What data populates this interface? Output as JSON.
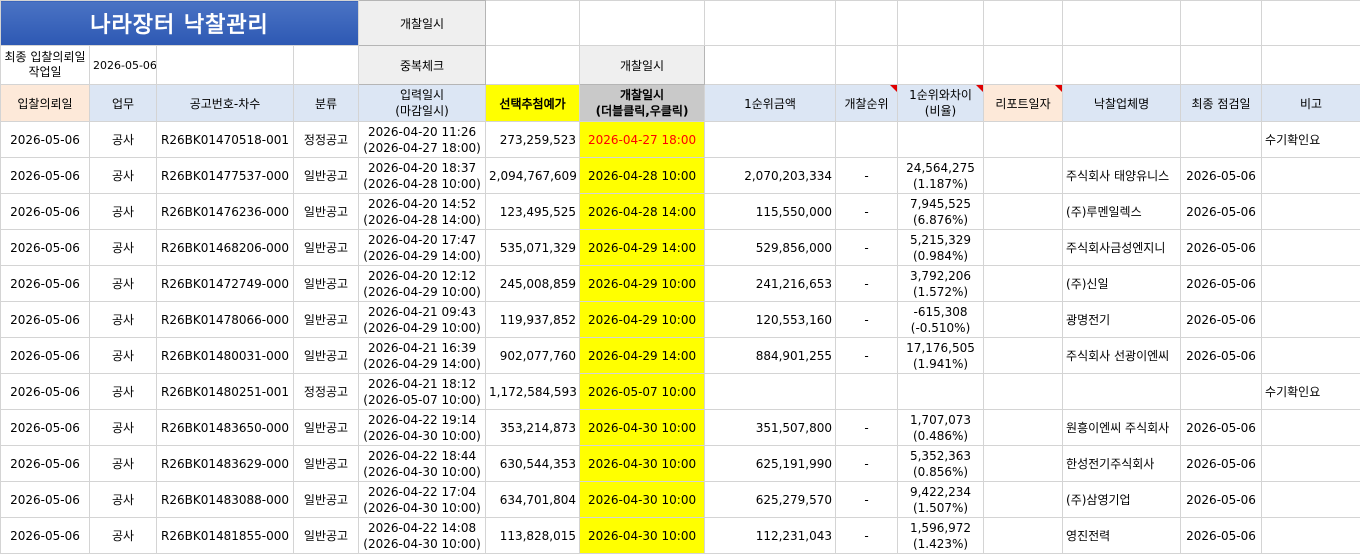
{
  "title": "나라장터 낙찰관리",
  "buttons": {
    "open_date_1": "개찰일시",
    "dup_check": "중복체크",
    "open_date_2": "개찰일시"
  },
  "work_date": {
    "label": "최종 입찰의뢰일 작업일",
    "value": "2026-05-06"
  },
  "headers": {
    "request_date": "입찰의뢰일",
    "task": "업무",
    "notice_no": "공고번호-차수",
    "category": "분류",
    "input_date_1": "입력일시",
    "input_date_2": "(마감일시)",
    "selected_price": "선택추첨예가",
    "open_date_1": "개찰일시",
    "open_date_2": "(더블클릭,우클릭)",
    "first_amount": "1순위금액",
    "open_rank": "개찰순위",
    "diff_1": "1순위와차이",
    "diff_2": "(비율)",
    "report_date": "리포트일자",
    "winner": "낙찰업체명",
    "final_check": "최종 점검일",
    "note": "비고"
  },
  "rows": [
    {
      "req": "2026-05-06",
      "task": "공사",
      "no": "R26BK01470518-001",
      "cat": "정정공고",
      "in1": "2026-04-20 11:26",
      "in2": "(2026-04-27 18:00)",
      "price": "273,259,523",
      "open": "2026-04-27  18:00",
      "amt": "",
      "rank": "",
      "d1": "",
      "d2": "",
      "report": "",
      "winner": "",
      "check": "",
      "note": "수기확인요"
    },
    {
      "req": "2026-05-06",
      "task": "공사",
      "no": "R26BK01477537-000",
      "cat": "일반공고",
      "in1": "2026-04-20 18:37",
      "in2": "(2026-04-28 10:00)",
      "price": "2,094,767,609",
      "open": "2026-04-28 10:00",
      "amt": "2,070,203,334",
      "rank": "-",
      "d1": "24,564,275",
      "d2": "(1.187%)",
      "report": "",
      "winner": "주식회사 태양유니스",
      "check": "2026-05-06",
      "note": ""
    },
    {
      "req": "2026-05-06",
      "task": "공사",
      "no": "R26BK01476236-000",
      "cat": "일반공고",
      "in1": "2026-04-20 14:52",
      "in2": "(2026-04-28 14:00)",
      "price": "123,495,525",
      "open": "2026-04-28 14:00",
      "amt": "115,550,000",
      "rank": "-",
      "d1": "7,945,525",
      "d2": "(6.876%)",
      "report": "",
      "winner": "(주)루멘일렉스",
      "check": "2026-05-06",
      "note": ""
    },
    {
      "req": "2026-05-06",
      "task": "공사",
      "no": "R26BK01468206-000",
      "cat": "일반공고",
      "in1": "2026-04-20 17:47",
      "in2": "(2026-04-29 14:00)",
      "price": "535,071,329",
      "open": "2026-04-29 14:00",
      "amt": "529,856,000",
      "rank": "-",
      "d1": "5,215,329",
      "d2": "(0.984%)",
      "report": "",
      "winner": "주식회사금성엔지니",
      "check": "2026-05-06",
      "note": ""
    },
    {
      "req": "2026-05-06",
      "task": "공사",
      "no": "R26BK01472749-000",
      "cat": "일반공고",
      "in1": "2026-04-20 12:12",
      "in2": "(2026-04-29 10:00)",
      "price": "245,008,859",
      "open": "2026-04-29 10:00",
      "amt": "241,216,653",
      "rank": "-",
      "d1": "3,792,206",
      "d2": "(1.572%)",
      "report": "",
      "winner": "(주)신일",
      "check": "2026-05-06",
      "note": ""
    },
    {
      "req": "2026-05-06",
      "task": "공사",
      "no": "R26BK01478066-000",
      "cat": "일반공고",
      "in1": "2026-04-21 09:43",
      "in2": "(2026-04-29 10:00)",
      "price": "119,937,852",
      "open": "2026-04-29 10:00",
      "amt": "120,553,160",
      "rank": "-",
      "d1": "-615,308",
      "d2": "(-0.510%)",
      "report": "",
      "winner": "광명전기",
      "check": "2026-05-06",
      "note": ""
    },
    {
      "req": "2026-05-06",
      "task": "공사",
      "no": "R26BK01480031-000",
      "cat": "일반공고",
      "in1": "2026-04-21 16:39",
      "in2": "(2026-04-29 14:00)",
      "price": "902,077,760",
      "open": "2026-04-29 14:00",
      "amt": "884,901,255",
      "rank": "-",
      "d1": "17,176,505",
      "d2": "(1.941%)",
      "report": "",
      "winner": "주식회사 선광이엔씨",
      "check": "2026-05-06",
      "note": ""
    },
    {
      "req": "2026-05-06",
      "task": "공사",
      "no": "R26BK01480251-001",
      "cat": "정정공고",
      "in1": "2026-04-21 18:12",
      "in2": "(2026-05-07 10:00)",
      "price": "1,172,584,593",
      "open": "2026-05-07 10:00",
      "amt": "",
      "rank": "",
      "d1": "",
      "d2": "",
      "report": "",
      "winner": "",
      "check": "",
      "note": "수기확인요"
    },
    {
      "req": "2026-05-06",
      "task": "공사",
      "no": "R26BK01483650-000",
      "cat": "일반공고",
      "in1": "2026-04-22 19:14",
      "in2": "(2026-04-30 10:00)",
      "price": "353,214,873",
      "open": "2026-04-30 10:00",
      "amt": "351,507,800",
      "rank": "-",
      "d1": "1,707,073",
      "d2": "(0.486%)",
      "report": "",
      "winner": "원흥이엔씨 주식회사",
      "check": "2026-05-06",
      "note": ""
    },
    {
      "req": "2026-05-06",
      "task": "공사",
      "no": "R26BK01483629-000",
      "cat": "일반공고",
      "in1": "2026-04-22 18:44",
      "in2": "(2026-04-30 10:00)",
      "price": "630,544,353",
      "open": "2026-04-30 10:00",
      "amt": "625,191,990",
      "rank": "-",
      "d1": "5,352,363",
      "d2": "(0.856%)",
      "report": "",
      "winner": "한성전기주식회사",
      "check": "2026-05-06",
      "note": ""
    },
    {
      "req": "2026-05-06",
      "task": "공사",
      "no": "R26BK01483088-000",
      "cat": "일반공고",
      "in1": "2026-04-22 17:04",
      "in2": "(2026-04-30 10:00)",
      "price": "634,701,804",
      "open": "2026-04-30 10:00",
      "amt": "625,279,570",
      "rank": "-",
      "d1": "9,422,234",
      "d2": "(1.507%)",
      "report": "",
      "winner": "(주)삼영기업",
      "check": "2026-05-06",
      "note": ""
    },
    {
      "req": "2026-05-06",
      "task": "공사",
      "no": "R26BK01481855-000",
      "cat": "일반공고",
      "in1": "2026-04-22 14:08",
      "in2": "(2026-04-30 10:00)",
      "price": "113,828,015",
      "open": "2026-04-30 10:00",
      "amt": "112,231,043",
      "rank": "-",
      "d1": "1,596,972",
      "d2": "(1.423%)",
      "report": "",
      "winner": "영진전력",
      "check": "2026-05-06",
      "note": ""
    }
  ],
  "colors": {
    "title_bg": "#3a66c0",
    "header_orange": "#fde9d9",
    "header_blue": "#dce6f4",
    "highlight_yellow": "#ffff00",
    "header_gray": "#c9c9c9",
    "alert_red": "#ff0000"
  }
}
